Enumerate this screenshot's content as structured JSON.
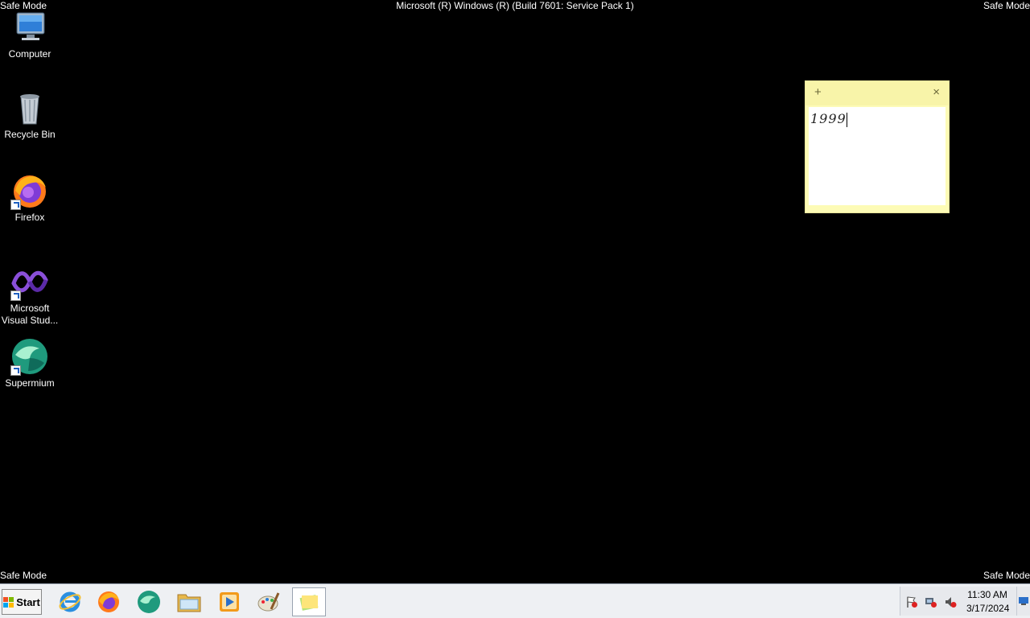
{
  "watermark": {
    "top_left": "Safe Mode",
    "top_right": "Safe Mode",
    "bottom_left": "Safe Mode",
    "bottom_right": "Safe Mode",
    "title": "Microsoft (R) Windows (R) (Build 7601: Service Pack 1)"
  },
  "desktop_icons": [
    {
      "label": "Computer",
      "icon": "computer-icon"
    },
    {
      "label": "Recycle Bin",
      "icon": "recycle-bin-icon"
    },
    {
      "label": "Firefox",
      "icon": "firefox-icon"
    },
    {
      "label": "Microsoft Visual Stud...",
      "icon": "visual-studio-icon"
    },
    {
      "label": "Supermium",
      "icon": "supermium-icon"
    }
  ],
  "sticky_note": {
    "add_glyph": "+",
    "close_glyph": "×",
    "text": "1999",
    "colors": {
      "bar": "#f8f4a9",
      "frame": "#fdfbb6"
    }
  },
  "taskbar": {
    "start_label": "Start",
    "pinned": [
      {
        "name": "internet-explorer",
        "icon": "internet-explorer-icon"
      },
      {
        "name": "firefox",
        "icon": "firefox-icon"
      },
      {
        "name": "supermium",
        "icon": "supermium-icon"
      },
      {
        "name": "windows-explorer",
        "icon": "folder-icon"
      },
      {
        "name": "media-player",
        "icon": "media-player-icon"
      },
      {
        "name": "paint",
        "icon": "paint-icon"
      },
      {
        "name": "sticky-notes",
        "icon": "sticky-notes-icon",
        "active": true
      }
    ],
    "clock": {
      "time": "11:30 AM",
      "date": "3/17/2024"
    }
  }
}
